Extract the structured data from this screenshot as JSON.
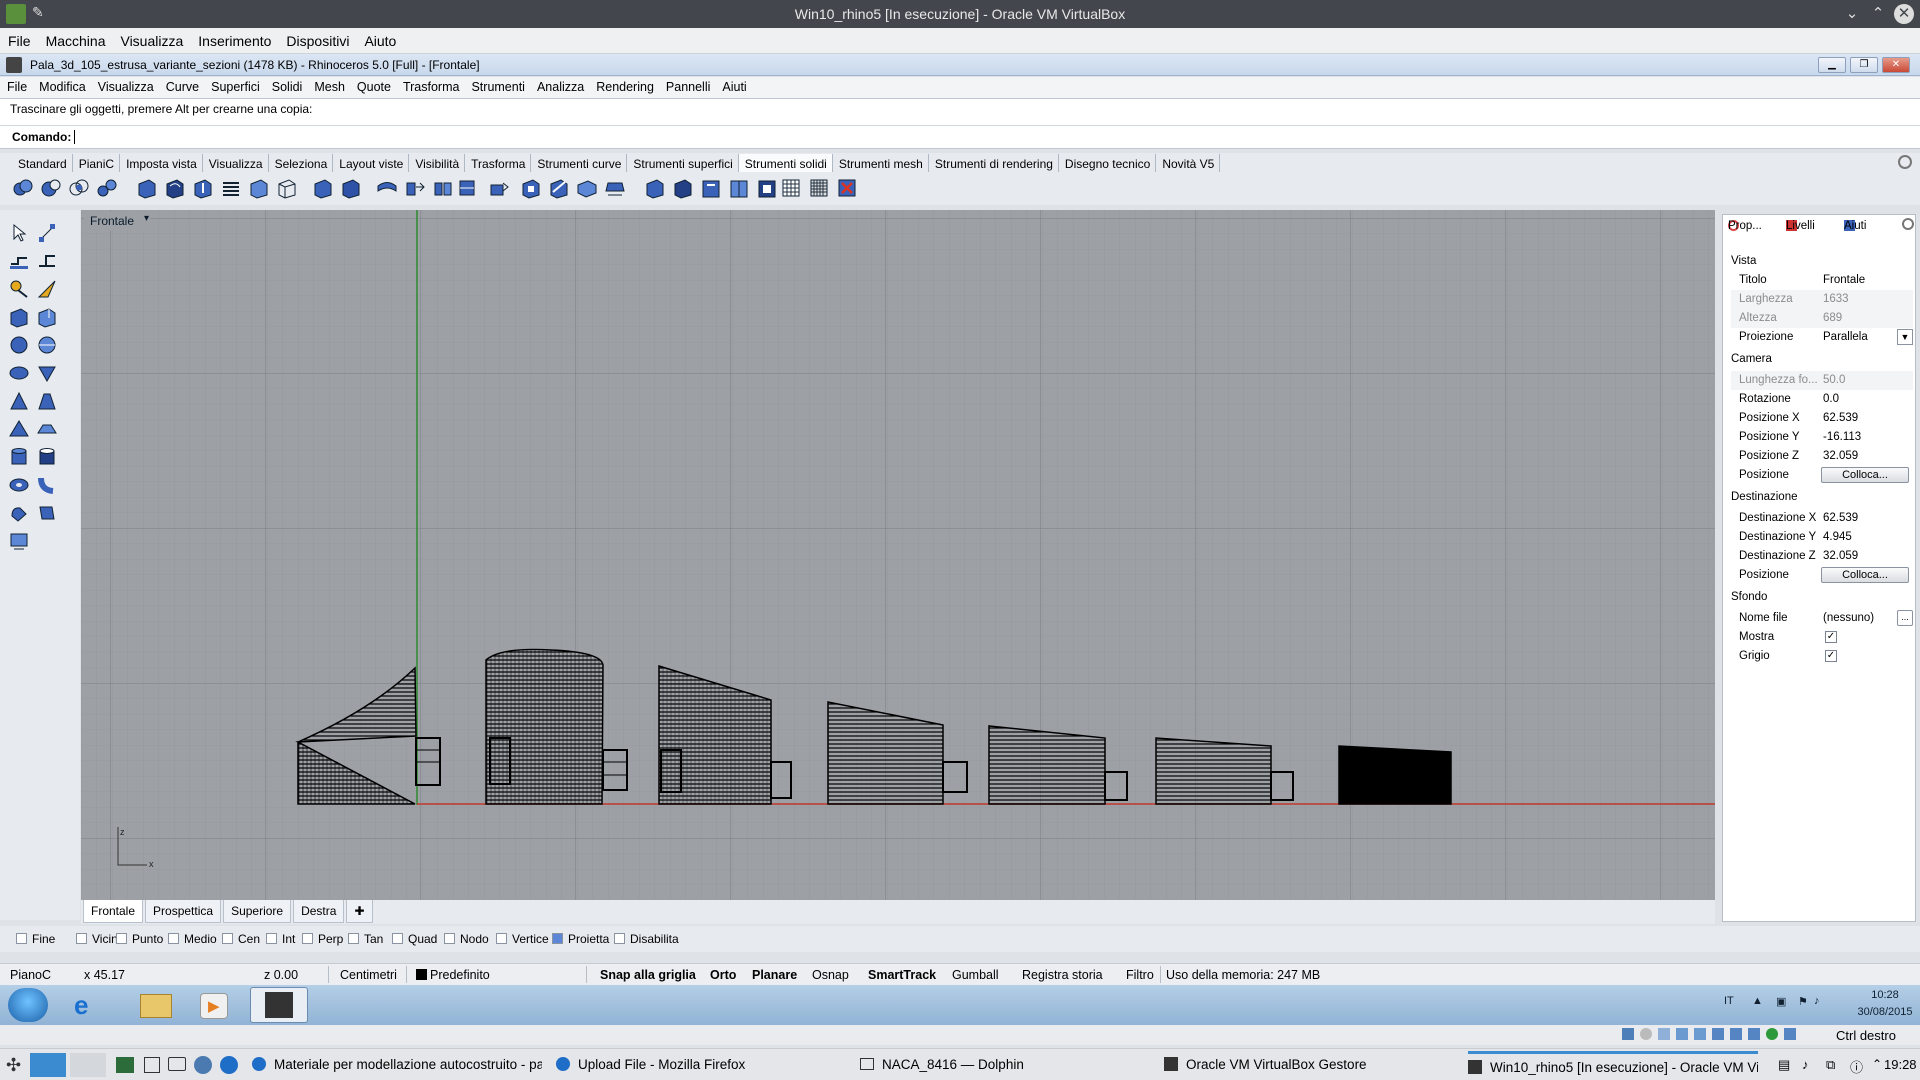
{
  "host": {
    "title": "Win10_rhino5 [In esecuzione] - Oracle VM VirtualBox",
    "menu": [
      "File",
      "Macchina",
      "Visualizza",
      "Inserimento",
      "Dispositivi",
      "Aiuto"
    ]
  },
  "rhino": {
    "title": "Pala_3d_105_estrusa_variante_sezioni (1478 KB) - Rhinoceros 5.0 [Full] - [Frontale]",
    "menu": [
      "File",
      "Modifica",
      "Visualizza",
      "Curve",
      "Superfici",
      "Solidi",
      "Mesh",
      "Quote",
      "Trasforma",
      "Strumenti",
      "Analizza",
      "Rendering",
      "Pannelli",
      "Aiuti"
    ],
    "command_history": "Trascinare gli oggetti, premere Alt per crearne una copia:",
    "command_label": "Comando:",
    "toolbar_tabs": [
      "Standard",
      "PianiC",
      "Imposta vista",
      "Visualizza",
      "Seleziona",
      "Layout viste",
      "Visibilità",
      "Trasforma",
      "Strumenti curve",
      "Strumenti superfici",
      "Strumenti solidi",
      "Strumenti mesh",
      "Strumenti di rendering",
      "Disegno tecnico",
      "Novità V5"
    ],
    "active_toolbar_tab": "Strumenti solidi",
    "viewport_title": "Frontale",
    "axis_z": "z",
    "axis_x": "x",
    "viewport_tabs": [
      "Frontale",
      "Prospettica",
      "Superiore",
      "Destra"
    ],
    "osnap": [
      "Fine",
      "Vicino",
      "Punto",
      "Medio",
      "Cen",
      "Int",
      "Perp",
      "Tan",
      "Quad",
      "Nodo",
      "Vertice",
      "Proietta",
      "Disabilita"
    ],
    "status": {
      "cplane": "PianoC",
      "x": "x 45.17",
      "z": "z 0.00",
      "units": "Centimetri",
      "layer": "Predefinito",
      "snap": "Snap alla griglia",
      "orto": "Orto",
      "planare": "Planare",
      "osnap": "Osnap",
      "smarttrack": "SmartTrack",
      "gumball": "Gumball",
      "history": "Registra storia",
      "filter": "Filtro",
      "memory": "Uso della memoria: 247 MB"
    }
  },
  "panel": {
    "tabs": [
      "Prop...",
      "Livelli",
      "Aiuti"
    ],
    "sections": {
      "vista": "Vista",
      "camera": "Camera",
      "destinazione": "Destinazione",
      "sfondo": "Sfondo"
    },
    "vista_rows": [
      {
        "k": "Titolo",
        "v": "Frontale"
      },
      {
        "k": "Larghezza",
        "v": "1633"
      },
      {
        "k": "Altezza",
        "v": "689"
      },
      {
        "k": "Proiezione",
        "v": "Parallela"
      }
    ],
    "camera_rows": [
      {
        "k": "Lunghezza fo...",
        "v": "50.0"
      },
      {
        "k": "Rotazione",
        "v": "0.0"
      },
      {
        "k": "Posizione X",
        "v": "62.539"
      },
      {
        "k": "Posizione Y",
        "v": "-16.113"
      },
      {
        "k": "Posizione Z",
        "v": "32.059"
      },
      {
        "k": "Posizione",
        "v": "Colloca..."
      }
    ],
    "dest_rows": [
      {
        "k": "Destinazione X",
        "v": "62.539"
      },
      {
        "k": "Destinazione Y",
        "v": "4.945"
      },
      {
        "k": "Destinazione Z",
        "v": "32.059"
      },
      {
        "k": "Posizione",
        "v": "Colloca..."
      }
    ],
    "sfondo_rows": [
      {
        "k": "Nome file",
        "v": "(nessuno)"
      },
      {
        "k": "Mostra",
        "v": "✓"
      },
      {
        "k": "Grigio",
        "v": "✓"
      }
    ]
  },
  "guest_tray": {
    "lang": "IT",
    "time": "10:28",
    "date": "30/08/2015"
  },
  "vbox_status": {
    "hostkey": "Ctrl destro"
  },
  "host_taskbar": {
    "items": [
      "Materiale per modellazione autocostruito - pa",
      "Upload File - Mozilla Firefox",
      "NACA_8416 — Dolphin",
      "Oracle VM VirtualBox Gestore",
      "Win10_rhino5 [In esecuzione] - Oracle VM Vi"
    ],
    "time": "19:28"
  }
}
